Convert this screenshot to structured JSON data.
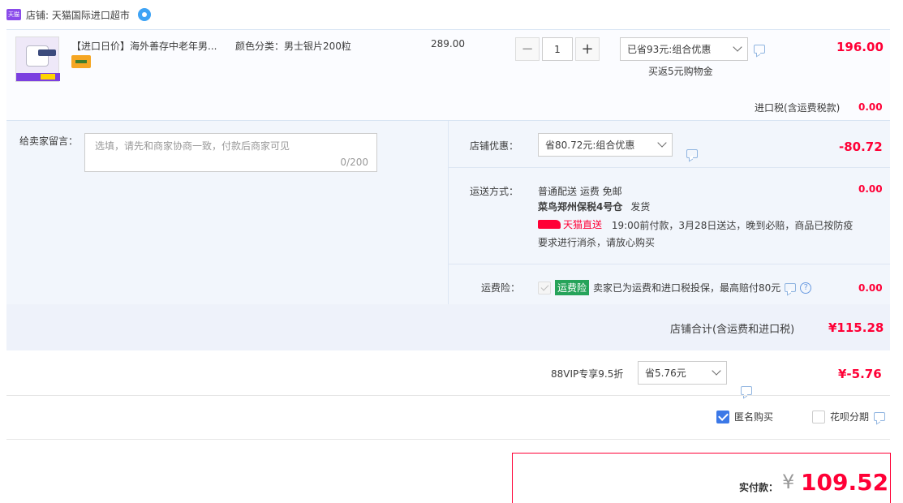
{
  "shop": {
    "badge": "天猫",
    "label": "店铺: 天猫国际进口超市"
  },
  "item": {
    "title": "【进口日价】海外善存中老年男...",
    "spec": "颜色分类：男士银片200粒",
    "unit_price": "289.00",
    "quantity": "1",
    "promo_select": "已省93元:组合优惠",
    "rebate": "买返5元购物金",
    "subtotal": "196.00",
    "tax_label": "进口税(含运费税款)",
    "tax_value": "0.00"
  },
  "message": {
    "label": "给卖家留言：",
    "placeholder": "选填，请先和商家协商一致，付款后商家可见",
    "counter": "0/200"
  },
  "shop_discount": {
    "label": "店铺优惠：",
    "select": "省80.72元:组合优惠",
    "value": "-80.72"
  },
  "shipping": {
    "label": "运送方式：",
    "method": "普通配送 运费 免邮",
    "warehouse": "菜鸟郑州保税4号仓",
    "ship_text": "发货",
    "tmall_direct": "天猫直送",
    "promise_line1": "19:00前付款，3月28日送达，晚到必赔，商品已按防疫",
    "promise_line2": "要求进行消杀，请放心购买",
    "value": "0.00"
  },
  "insurance": {
    "label": "运费险：",
    "badge": "运费险",
    "text": "卖家已为运费和进口税投保，最高赔付80元",
    "value": "0.00"
  },
  "shop_total": {
    "label": "店铺合计(含运费和进口税)",
    "value": "¥115.28"
  },
  "vip": {
    "label": "88VIP专享9.5折",
    "select": "省5.76元",
    "value": "¥-5.76"
  },
  "options": {
    "anonymous": "匿名购买",
    "huabei": "花呗分期"
  },
  "payment": {
    "label": "实付款：",
    "currency": "¥",
    "amount": "109.52"
  }
}
